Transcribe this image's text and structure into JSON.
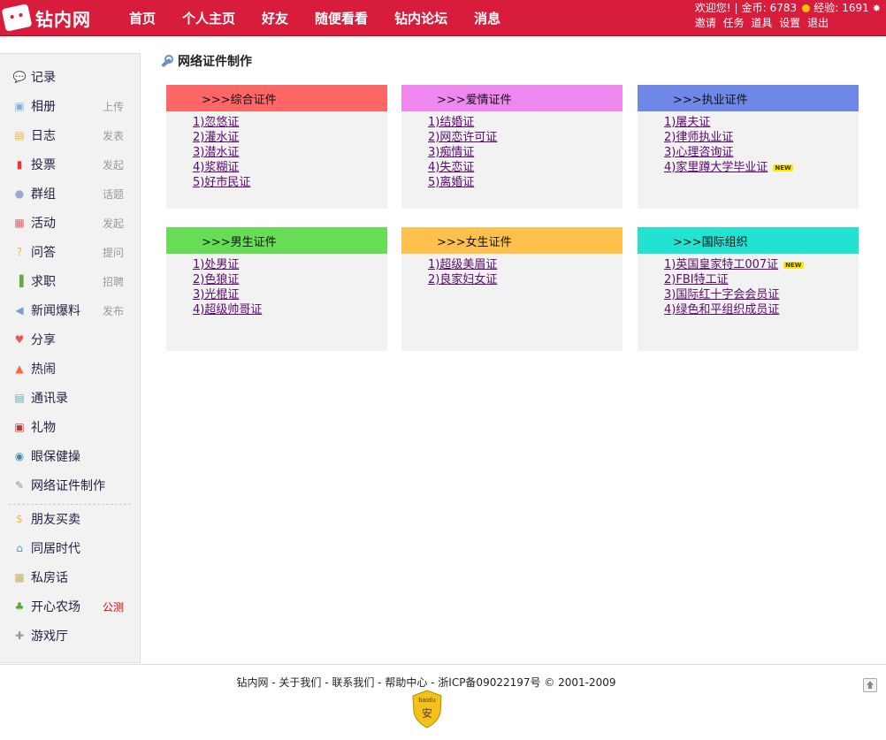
{
  "site": {
    "logo_text": "钻内网"
  },
  "nav": [
    "首页",
    "个人主页",
    "好友",
    "随便看看",
    "钻内论坛",
    "消息"
  ],
  "user": {
    "welcome": "欢迎您!",
    "coins_label": "金币:",
    "coins": "6783",
    "exp_label": "经验:",
    "exp": "1691",
    "links": [
      "邀请",
      "任务",
      "道具",
      "设置",
      "退出"
    ]
  },
  "sidebar": [
    {
      "label": "记录",
      "action": "",
      "icon": "speech-bubble-icon"
    },
    {
      "label": "相册",
      "action": "上传",
      "icon": "photo-icon"
    },
    {
      "label": "日志",
      "action": "发表",
      "icon": "journal-icon"
    },
    {
      "label": "投票",
      "action": "发起",
      "icon": "bar-chart-icon"
    },
    {
      "label": "群组",
      "action": "话题",
      "icon": "group-icon"
    },
    {
      "label": "活动",
      "action": "发起",
      "icon": "calendar-icon"
    },
    {
      "label": "问答",
      "action": "提问",
      "icon": "question-icon"
    },
    {
      "label": "求职",
      "action": "招聘",
      "icon": "door-icon"
    },
    {
      "label": "新闻爆料",
      "action": "发布",
      "icon": "speaker-icon"
    },
    {
      "label": "分享",
      "action": "",
      "icon": "hearts-icon"
    },
    {
      "label": "热闹",
      "action": "",
      "icon": "fire-icon"
    },
    {
      "label": "通讯录",
      "action": "",
      "icon": "contacts-icon"
    },
    {
      "label": "礼物",
      "action": "",
      "icon": "gift-icon"
    },
    {
      "label": "眼保健操",
      "action": "",
      "icon": "eye-icon"
    },
    {
      "label": "网络证件制作",
      "action": "",
      "icon": "wrench-icon"
    },
    {
      "label": "朋友买卖",
      "action": "",
      "icon": "trade-icon"
    },
    {
      "label": "同居时代",
      "action": "",
      "icon": "house-icon"
    },
    {
      "label": "私房话",
      "action": "",
      "icon": "lock-icon"
    },
    {
      "label": "开心农场",
      "action": "公测",
      "icon": "sprout-icon"
    },
    {
      "label": "游戏厅",
      "action": "",
      "icon": "gamepad-icon"
    }
  ],
  "page_title": "网络证件制作",
  "cards": [
    {
      "title": ">>>综合证件",
      "color": "#ff6666",
      "items": [
        "1)忽悠证",
        "2)灌水证",
        "3)潜水证",
        "4)浆糊证",
        "5)好市民证"
      ],
      "new": []
    },
    {
      "title": ">>>爱情证件",
      "color": "#ee88ee",
      "items": [
        "1)结婚证",
        "2)网恋许可证",
        "3)痴情证",
        "4)失恋证",
        "5)离婚证"
      ],
      "new": []
    },
    {
      "title": ">>>执业证件",
      "color": "#6f88e8",
      "items": [
        "1)屠夫证",
        "2)律师执业证",
        "3)心理咨询证",
        "4)家里蹲大学毕业证"
      ],
      "new": [
        3
      ]
    },
    {
      "title": ">>>男生证件",
      "color": "#66dd55",
      "items": [
        "1)处男证",
        "2)色狼证",
        "3)光棍证",
        "4)超级帅哥证"
      ],
      "new": []
    },
    {
      "title": ">>>女生证件",
      "color": "#ffc04c",
      "items": [
        "1)超级美眉证",
        "2)良家妇女证"
      ],
      "new": []
    },
    {
      "title": ">>>国际组织",
      "color": "#22e2d2",
      "items": [
        "1)英国皇家特工007证",
        "2)FBI特工证",
        "3)国际红十字会会员证",
        "4)绿色和平组织成员证"
      ],
      "new": [
        0
      ]
    }
  ],
  "new_badge": "NEW",
  "footer": {
    "text": "钻内网 - 关于我们 - 联系我们 - 帮助中心 - 浙ICP备09022197号 © 2001-2009",
    "badge_top": "baidu",
    "badge_char": "安"
  }
}
